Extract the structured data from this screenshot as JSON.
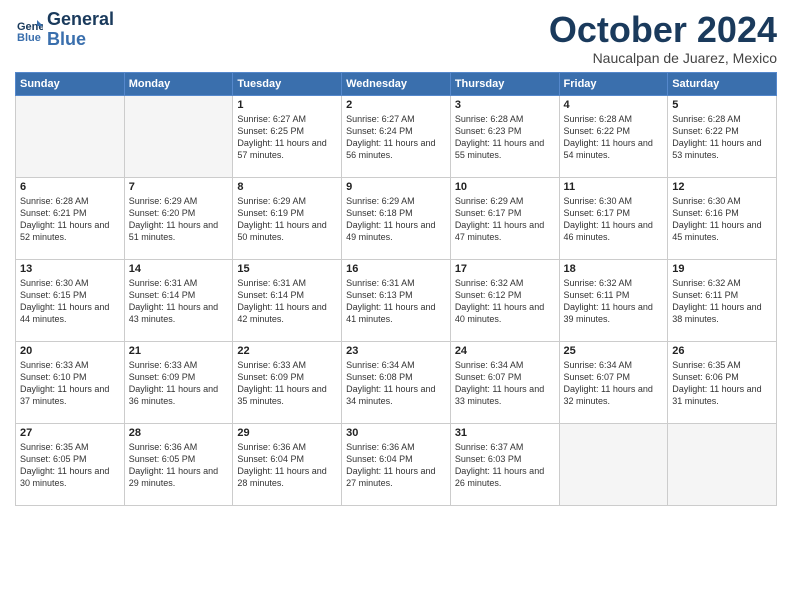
{
  "header": {
    "logo_line1": "General",
    "logo_line2": "Blue",
    "month_title": "October 2024",
    "location": "Naucalpan de Juarez, Mexico"
  },
  "weekdays": [
    "Sunday",
    "Monday",
    "Tuesday",
    "Wednesday",
    "Thursday",
    "Friday",
    "Saturday"
  ],
  "weeks": [
    [
      {
        "day": "",
        "empty": true
      },
      {
        "day": "",
        "empty": true
      },
      {
        "day": "1",
        "sunrise": "6:27 AM",
        "sunset": "6:25 PM",
        "daylight": "11 hours and 57 minutes."
      },
      {
        "day": "2",
        "sunrise": "6:27 AM",
        "sunset": "6:24 PM",
        "daylight": "11 hours and 56 minutes."
      },
      {
        "day": "3",
        "sunrise": "6:28 AM",
        "sunset": "6:23 PM",
        "daylight": "11 hours and 55 minutes."
      },
      {
        "day": "4",
        "sunrise": "6:28 AM",
        "sunset": "6:22 PM",
        "daylight": "11 hours and 54 minutes."
      },
      {
        "day": "5",
        "sunrise": "6:28 AM",
        "sunset": "6:22 PM",
        "daylight": "11 hours and 53 minutes."
      }
    ],
    [
      {
        "day": "6",
        "sunrise": "6:28 AM",
        "sunset": "6:21 PM",
        "daylight": "11 hours and 52 minutes."
      },
      {
        "day": "7",
        "sunrise": "6:29 AM",
        "sunset": "6:20 PM",
        "daylight": "11 hours and 51 minutes."
      },
      {
        "day": "8",
        "sunrise": "6:29 AM",
        "sunset": "6:19 PM",
        "daylight": "11 hours and 50 minutes."
      },
      {
        "day": "9",
        "sunrise": "6:29 AM",
        "sunset": "6:18 PM",
        "daylight": "11 hours and 49 minutes."
      },
      {
        "day": "10",
        "sunrise": "6:29 AM",
        "sunset": "6:17 PM",
        "daylight": "11 hours and 47 minutes."
      },
      {
        "day": "11",
        "sunrise": "6:30 AM",
        "sunset": "6:17 PM",
        "daylight": "11 hours and 46 minutes."
      },
      {
        "day": "12",
        "sunrise": "6:30 AM",
        "sunset": "6:16 PM",
        "daylight": "11 hours and 45 minutes."
      }
    ],
    [
      {
        "day": "13",
        "sunrise": "6:30 AM",
        "sunset": "6:15 PM",
        "daylight": "11 hours and 44 minutes."
      },
      {
        "day": "14",
        "sunrise": "6:31 AM",
        "sunset": "6:14 PM",
        "daylight": "11 hours and 43 minutes."
      },
      {
        "day": "15",
        "sunrise": "6:31 AM",
        "sunset": "6:14 PM",
        "daylight": "11 hours and 42 minutes."
      },
      {
        "day": "16",
        "sunrise": "6:31 AM",
        "sunset": "6:13 PM",
        "daylight": "11 hours and 41 minutes."
      },
      {
        "day": "17",
        "sunrise": "6:32 AM",
        "sunset": "6:12 PM",
        "daylight": "11 hours and 40 minutes."
      },
      {
        "day": "18",
        "sunrise": "6:32 AM",
        "sunset": "6:11 PM",
        "daylight": "11 hours and 39 minutes."
      },
      {
        "day": "19",
        "sunrise": "6:32 AM",
        "sunset": "6:11 PM",
        "daylight": "11 hours and 38 minutes."
      }
    ],
    [
      {
        "day": "20",
        "sunrise": "6:33 AM",
        "sunset": "6:10 PM",
        "daylight": "11 hours and 37 minutes."
      },
      {
        "day": "21",
        "sunrise": "6:33 AM",
        "sunset": "6:09 PM",
        "daylight": "11 hours and 36 minutes."
      },
      {
        "day": "22",
        "sunrise": "6:33 AM",
        "sunset": "6:09 PM",
        "daylight": "11 hours and 35 minutes."
      },
      {
        "day": "23",
        "sunrise": "6:34 AM",
        "sunset": "6:08 PM",
        "daylight": "11 hours and 34 minutes."
      },
      {
        "day": "24",
        "sunrise": "6:34 AM",
        "sunset": "6:07 PM",
        "daylight": "11 hours and 33 minutes."
      },
      {
        "day": "25",
        "sunrise": "6:34 AM",
        "sunset": "6:07 PM",
        "daylight": "11 hours and 32 minutes."
      },
      {
        "day": "26",
        "sunrise": "6:35 AM",
        "sunset": "6:06 PM",
        "daylight": "11 hours and 31 minutes."
      }
    ],
    [
      {
        "day": "27",
        "sunrise": "6:35 AM",
        "sunset": "6:05 PM",
        "daylight": "11 hours and 30 minutes."
      },
      {
        "day": "28",
        "sunrise": "6:36 AM",
        "sunset": "6:05 PM",
        "daylight": "11 hours and 29 minutes."
      },
      {
        "day": "29",
        "sunrise": "6:36 AM",
        "sunset": "6:04 PM",
        "daylight": "11 hours and 28 minutes."
      },
      {
        "day": "30",
        "sunrise": "6:36 AM",
        "sunset": "6:04 PM",
        "daylight": "11 hours and 27 minutes."
      },
      {
        "day": "31",
        "sunrise": "6:37 AM",
        "sunset": "6:03 PM",
        "daylight": "11 hours and 26 minutes."
      },
      {
        "day": "",
        "empty": true
      },
      {
        "day": "",
        "empty": true
      }
    ]
  ]
}
